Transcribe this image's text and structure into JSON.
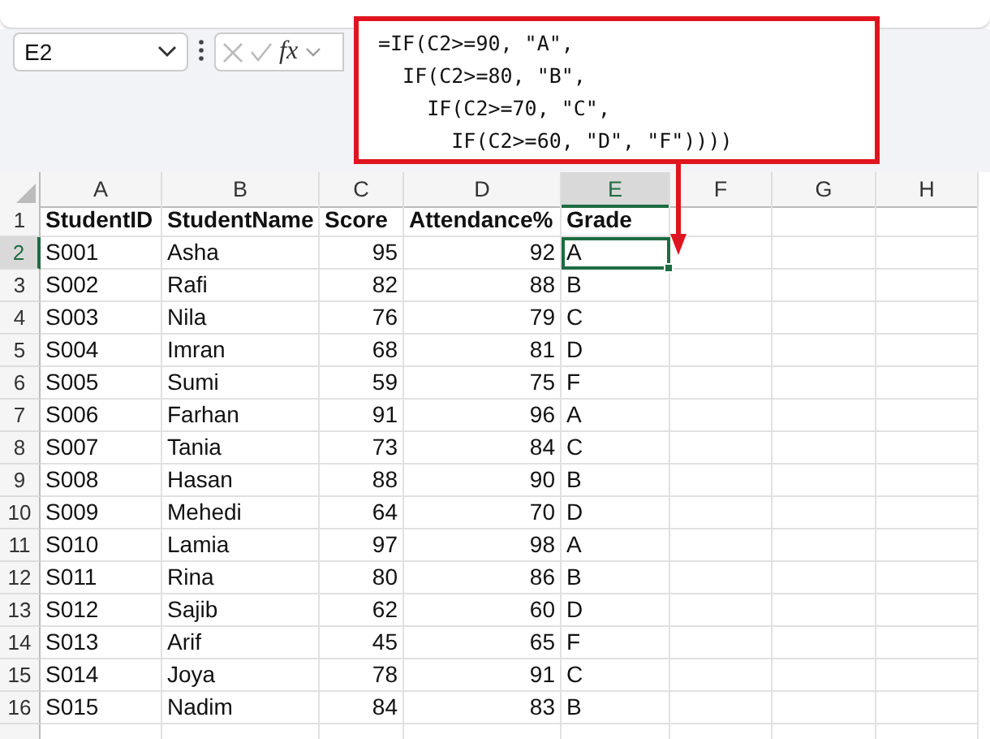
{
  "name_box": {
    "value": "E2"
  },
  "formula_bar": {
    "fx_label": "fx",
    "lines": [
      "=IF(C2>=90, \"A\",",
      "  IF(C2>=80, \"B\",",
      "    IF(C2>=70, \"C\",",
      "      IF(C2>=60, \"D\", \"F\"))))"
    ]
  },
  "columns": [
    {
      "label": "A",
      "kind": "text",
      "selected": false
    },
    {
      "label": "B",
      "kind": "text",
      "selected": false
    },
    {
      "label": "C",
      "kind": "number",
      "selected": false
    },
    {
      "label": "D",
      "kind": "number",
      "selected": false
    },
    {
      "label": "E",
      "kind": "text",
      "selected": true
    },
    {
      "label": "F",
      "kind": "text",
      "selected": false
    },
    {
      "label": "G",
      "kind": "text",
      "selected": false
    },
    {
      "label": "H",
      "kind": "text",
      "selected": false
    }
  ],
  "rows": [
    {
      "number": "1",
      "header": true,
      "selected": false,
      "cells": [
        "StudentID",
        "StudentName",
        "Score",
        "Attendance%",
        "Grade"
      ]
    },
    {
      "number": "2",
      "header": false,
      "selected": true,
      "cells": [
        "S001",
        "Asha",
        "95",
        "92",
        "A"
      ]
    },
    {
      "number": "3",
      "header": false,
      "selected": false,
      "cells": [
        "S002",
        "Rafi",
        "82",
        "88",
        "B"
      ]
    },
    {
      "number": "4",
      "header": false,
      "selected": false,
      "cells": [
        "S003",
        "Nila",
        "76",
        "79",
        "C"
      ]
    },
    {
      "number": "5",
      "header": false,
      "selected": false,
      "cells": [
        "S004",
        "Imran",
        "68",
        "81",
        "D"
      ]
    },
    {
      "number": "6",
      "header": false,
      "selected": false,
      "cells": [
        "S005",
        "Sumi",
        "59",
        "75",
        "F"
      ]
    },
    {
      "number": "7",
      "header": false,
      "selected": false,
      "cells": [
        "S006",
        "Farhan",
        "91",
        "96",
        "A"
      ]
    },
    {
      "number": "8",
      "header": false,
      "selected": false,
      "cells": [
        "S007",
        "Tania",
        "73",
        "84",
        "C"
      ]
    },
    {
      "number": "9",
      "header": false,
      "selected": false,
      "cells": [
        "S008",
        "Hasan",
        "88",
        "90",
        "B"
      ]
    },
    {
      "number": "10",
      "header": false,
      "selected": false,
      "cells": [
        "S009",
        "Mehedi",
        "64",
        "70",
        "D"
      ]
    },
    {
      "number": "11",
      "header": false,
      "selected": false,
      "cells": [
        "S010",
        "Lamia",
        "97",
        "98",
        "A"
      ]
    },
    {
      "number": "12",
      "header": false,
      "selected": false,
      "cells": [
        "S011",
        "Rina",
        "80",
        "86",
        "B"
      ]
    },
    {
      "number": "13",
      "header": false,
      "selected": false,
      "cells": [
        "S012",
        "Sajib",
        "62",
        "60",
        "D"
      ]
    },
    {
      "number": "14",
      "header": false,
      "selected": false,
      "cells": [
        "S013",
        "Arif",
        "45",
        "65",
        "F"
      ]
    },
    {
      "number": "15",
      "header": false,
      "selected": false,
      "cells": [
        "S014",
        "Joya",
        "78",
        "91",
        "C"
      ]
    },
    {
      "number": "16",
      "header": false,
      "selected": false,
      "cells": [
        "S015",
        "Nadim",
        "84",
        "83",
        "B"
      ]
    }
  ]
}
